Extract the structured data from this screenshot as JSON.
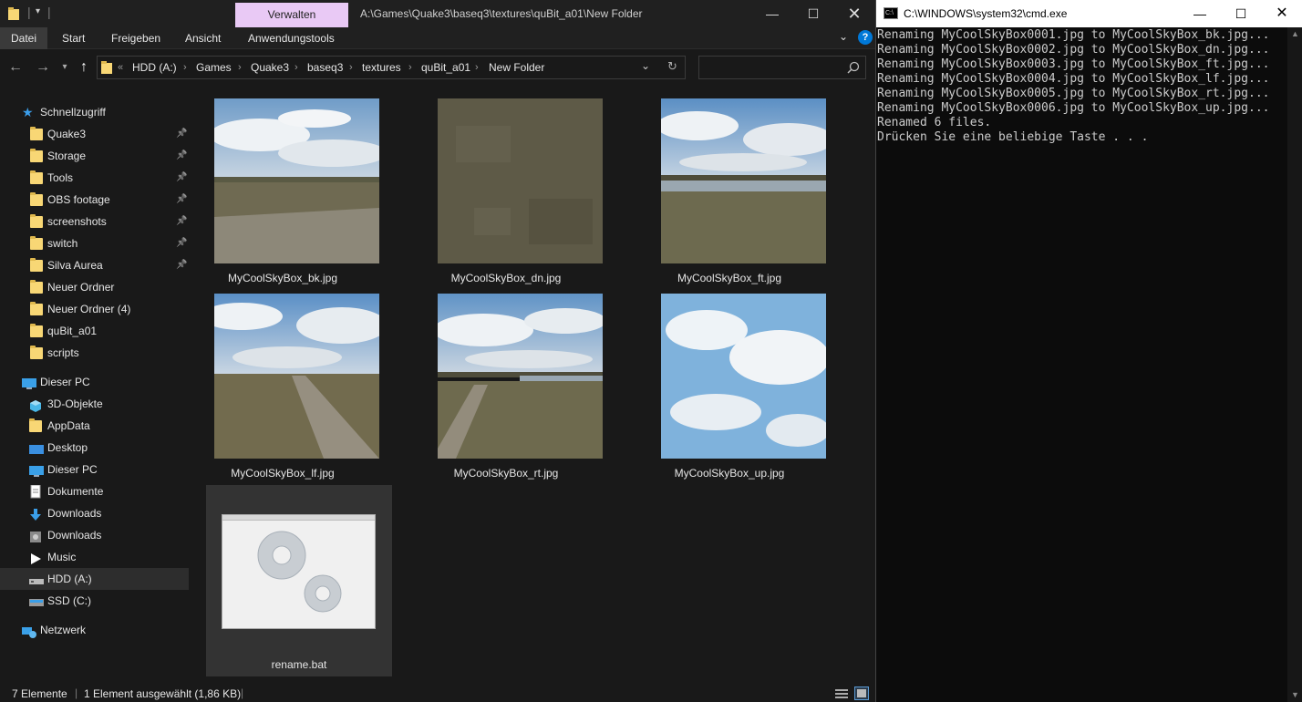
{
  "explorer": {
    "title_path": "A:\\Games\\Quake3\\baseq3\\textures\\quBit_a01\\New Folder",
    "context_tab": "Verwalten",
    "ribbon_tabs": [
      "Datei",
      "Start",
      "Freigeben",
      "Ansicht",
      "Anwendungstools"
    ],
    "breadcrumb": [
      "HDD (A:)",
      "Games",
      "Quake3",
      "baseq3",
      "textures",
      "quBit_a01",
      "New Folder"
    ],
    "breadcrumb_overflow": "«",
    "search_placeholder": "",
    "nav": {
      "quick_access": "Schnellzugriff",
      "quick_items": [
        "Quake3",
        "Storage",
        "Tools",
        "OBS footage",
        "screenshots",
        "switch",
        "Silva Aurea",
        "Neuer Ordner",
        "Neuer Ordner (4)",
        "quBit_a01",
        "scripts"
      ],
      "pinned_count": 7,
      "this_pc": "Dieser PC",
      "pc_items": [
        "3D-Objekte",
        "AppData",
        "Desktop",
        "Dieser PC",
        "Dokumente",
        "Downloads",
        "Downloads",
        "Music",
        "HDD (A:)",
        "SSD (C:)"
      ],
      "network": "Netzwerk"
    },
    "files": [
      {
        "name": "MyCoolSkyBox_bk.jpg",
        "kind": "sky-ground"
      },
      {
        "name": "MyCoolSkyBox_dn.jpg",
        "kind": "ground"
      },
      {
        "name": "MyCoolSkyBox_ft.jpg",
        "kind": "sky-lake"
      },
      {
        "name": "MyCoolSkyBox_lf.jpg",
        "kind": "sky-road"
      },
      {
        "name": "MyCoolSkyBox_rt.jpg",
        "kind": "sky-road-lake"
      },
      {
        "name": "MyCoolSkyBox_up.jpg",
        "kind": "sky"
      },
      {
        "name": "rename.bat",
        "kind": "batch"
      }
    ],
    "status": {
      "count": "7 Elemente",
      "selection": "1 Element ausgewählt (1,86 KB)"
    }
  },
  "cmd": {
    "title": "C:\\WINDOWS\\system32\\cmd.exe",
    "lines": [
      "Renaming MyCoolSkyBox0001.jpg to MyCoolSkyBox_bk.jpg...",
      "Renaming MyCoolSkyBox0002.jpg to MyCoolSkyBox_dn.jpg...",
      "Renaming MyCoolSkyBox0003.jpg to MyCoolSkyBox_ft.jpg...",
      "Renaming MyCoolSkyBox0004.jpg to MyCoolSkyBox_lf.jpg...",
      "Renaming MyCoolSkyBox0005.jpg to MyCoolSkyBox_rt.jpg...",
      "Renaming MyCoolSkyBox0006.jpg to MyCoolSkyBox_up.jpg...",
      "Renamed 6 files.",
      "Drücken Sie eine beliebige Taste . . ."
    ]
  },
  "colors": {
    "folder": "#f8d775",
    "context_tab": "#e9c9f5",
    "accent": "#0078d7"
  }
}
